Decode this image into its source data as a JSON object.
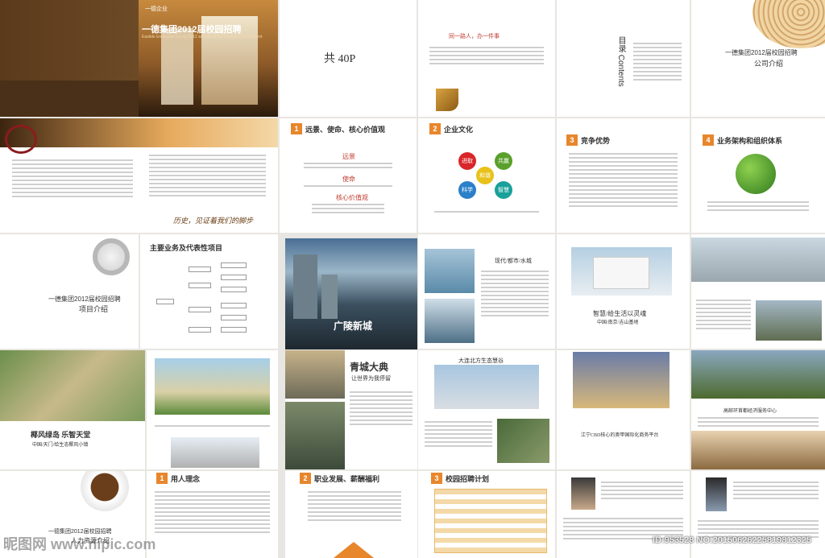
{
  "cover": {
    "brand": "一德企业",
    "title": "一德集团2012届校园招聘",
    "subtitle": "Eastide Enterprise Group 2012 session of the Campus Recruitment"
  },
  "count": {
    "label": "共 40P"
  },
  "intro_slogan": "同一路人，办一件事",
  "toc": {
    "title": "目录 Contents"
  },
  "company_intro": {
    "line1": "一德集团2012届校园招聘",
    "line2": "公司介绍"
  },
  "history_caption": "历史，见证着我们的脚步",
  "sections": {
    "s1": {
      "num": "1",
      "label": "远景、使命、核心价值观"
    },
    "s2": {
      "num": "2",
      "label": "企业文化"
    },
    "s3": {
      "num": "3",
      "label": "竞争优势"
    },
    "s4": {
      "num": "4",
      "label": "业务架构和组织体系"
    }
  },
  "values": {
    "vision": "远景",
    "mission": "使命",
    "core": "核心价值观"
  },
  "culture_circles": [
    "进取",
    "共赢",
    "科学",
    "智慧",
    "和谐"
  ],
  "project_intro": {
    "line1": "一德集团2012届校园招聘",
    "line2": "项目介绍"
  },
  "business_title": "主要业务及代表性项目",
  "guangling": "广陵新城",
  "qingcheng": {
    "title": "青城大典",
    "sub": "让世界为我停留"
  },
  "modern_title": "现代/都市/水城",
  "wisdom": {
    "title": "智慧/给生活以灵魂",
    "sub": "中国/南京/吉山基地"
  },
  "dalian_title": "大连北方生态慧谷",
  "jiangning_title": "江宁CBD核心的奥甲国际化商务平台",
  "gaotie_title": "高邮环首都经济服务中心",
  "coconut": {
    "title": "椰风绿岛  乐智天堂",
    "sub": "中国/天门/给生态椰风小镇"
  },
  "hr_intro": {
    "line1": "一德集团2012届校园招聘",
    "line2": "人力资源介绍"
  },
  "hr_sections": {
    "h1": {
      "num": "1",
      "label": "用人理念"
    },
    "h2": {
      "num": "2",
      "label": "职业发展、薪酬福利"
    },
    "h3": {
      "num": "3",
      "label": "校园招聘计划"
    }
  },
  "watermark": {
    "left": "昵图网 www.nipic.com",
    "right": "ID:953528 NO:20150626225819812325"
  },
  "colors": {
    "accent": "#e8862c",
    "green": "#5aa02c"
  }
}
